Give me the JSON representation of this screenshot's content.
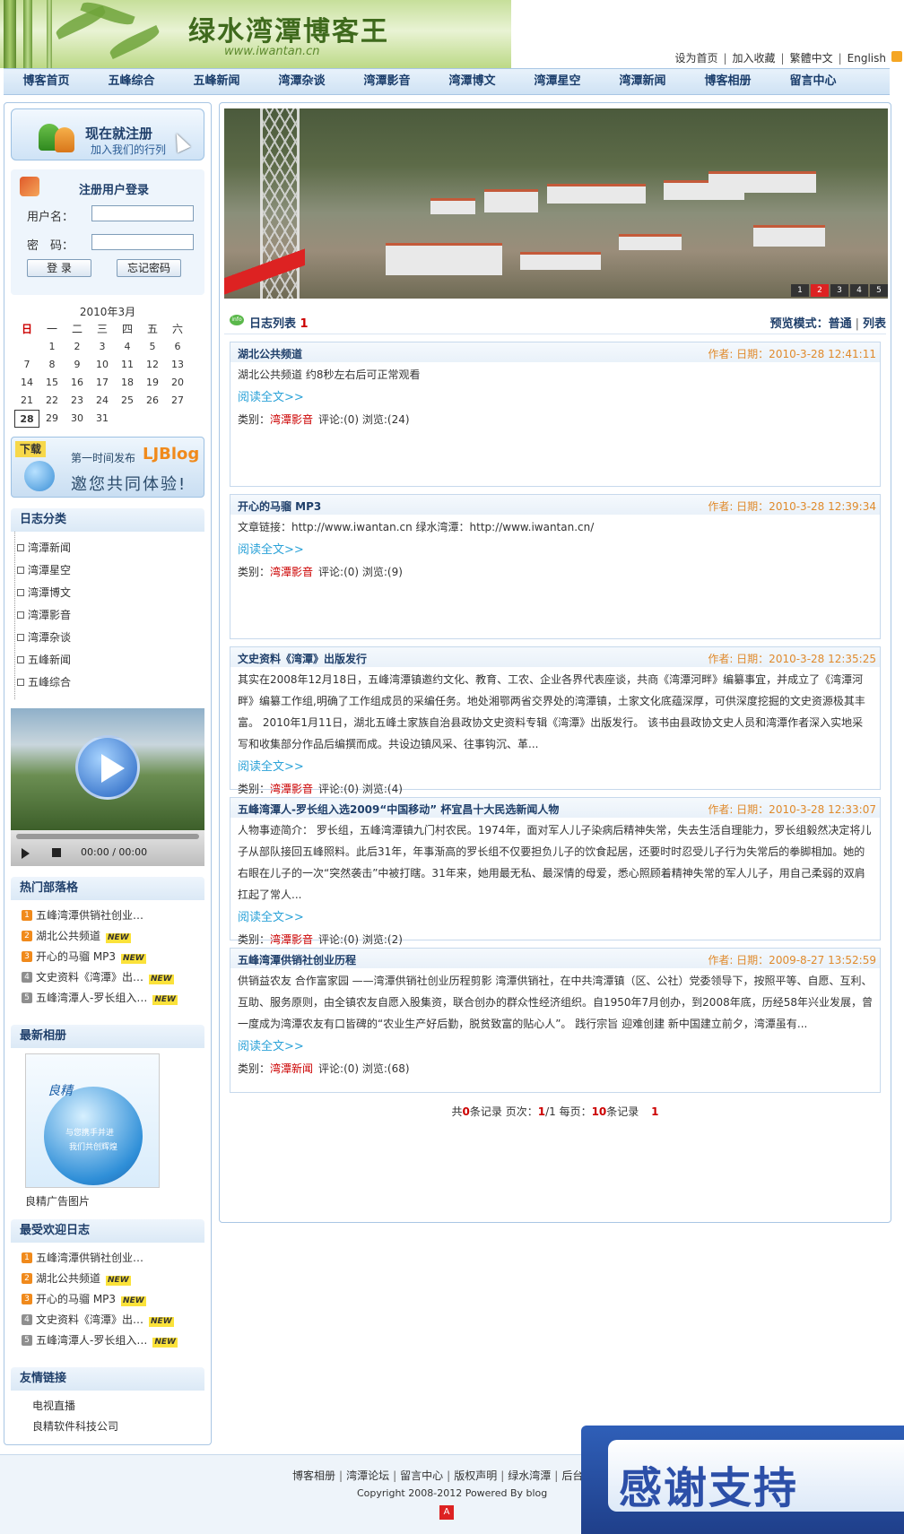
{
  "banner": {
    "title": "绿水湾潭博客王",
    "url": "www.iwantan.cn"
  },
  "toplinks": [
    "设为首页",
    "加入收藏",
    "繁體中文",
    "English"
  ],
  "nav": [
    "博客首页",
    "五峰综合",
    "五峰新闻",
    "湾潭杂谈",
    "湾潭影音",
    "湾潭博文",
    "湾潭星空",
    "湾潭新闻",
    "博客相册",
    "留言中心"
  ],
  "register": {
    "title": "现在就注册",
    "subtitle": "加入我们的行列"
  },
  "login": {
    "title": "注册用户登录",
    "username_label": "用户名：",
    "password_label": "密　码：",
    "login_button": "登 录",
    "forget_button": "忘记密码"
  },
  "calendar": {
    "title": "2010年3月",
    "days_of_week": [
      "日",
      "一",
      "二",
      "三",
      "四",
      "五",
      "六"
    ],
    "days": [
      "",
      "1",
      "2",
      "3",
      "4",
      "5",
      "6",
      "7",
      "8",
      "9",
      "10",
      "11",
      "12",
      "13",
      "14",
      "15",
      "16",
      "17",
      "18",
      "19",
      "20",
      "21",
      "22",
      "23",
      "24",
      "25",
      "26",
      "27",
      "28",
      "29",
      "30",
      "31"
    ],
    "today": "28"
  },
  "download_banner": {
    "tag": "下载",
    "text1": "第一时间发布",
    "brand": "LJBlog",
    "text2": "邀您共同体验!"
  },
  "categories": {
    "title": "日志分类",
    "items": [
      "湾潭新闻",
      "湾潭星空",
      "湾潭博文",
      "湾潭影音",
      "湾潭杂谈",
      "五峰新闻",
      "五峰综合"
    ]
  },
  "video": {
    "time": "00:00 / 00:00"
  },
  "hot": {
    "title": "热门部落格",
    "items": [
      {
        "num": "1",
        "text": "五峰湾潭供销社创业…",
        "new": ""
      },
      {
        "num": "2",
        "text": "湖北公共频道",
        "new": "NEW"
      },
      {
        "num": "3",
        "text": "开心的马骝  MP3",
        "new": "NEW"
      },
      {
        "num": "4",
        "text": "文史资料《湾潭》出…",
        "new": "NEW"
      },
      {
        "num": "5",
        "text": "五峰湾潭人-罗长组入…",
        "new": "NEW"
      }
    ]
  },
  "album": {
    "title": "最新相册",
    "brand": "良精",
    "line1": "与您携手并进",
    "line2": "我们共创辉煌",
    "caption": "良精广告图片"
  },
  "popular": {
    "title": "最受欢迎日志",
    "items": [
      {
        "num": "1",
        "text": "五峰湾潭供销社创业…",
        "new": ""
      },
      {
        "num": "2",
        "text": "湖北公共频道",
        "new": "NEW"
      },
      {
        "num": "3",
        "text": "开心的马骝  MP3",
        "new": "NEW"
      },
      {
        "num": "4",
        "text": "文史资料《湾潭》出…",
        "new": "NEW"
      },
      {
        "num": "5",
        "text": "五峰湾潭人-罗长组入…",
        "new": "NEW"
      }
    ]
  },
  "links": {
    "title": "友情链接",
    "items": [
      "电视直播",
      "良精软件科技公司"
    ]
  },
  "slideshow": {
    "numbers": [
      "1",
      "2",
      "3",
      "4",
      "5"
    ],
    "active": "2"
  },
  "log": {
    "title": "日志列表",
    "count": "1",
    "preview_label": "预览模式：",
    "mode_normal": "普通",
    "mode_list": "列表"
  },
  "entries": [
    {
      "title": "湖北公共频道",
      "meta": "作者: 日期：2010-3-28 12:41:11",
      "body": "湖北公共频道  约8秒左右后可正常观看",
      "more": "阅读全文>>",
      "category_label": "类别：",
      "category": "湾潭影音",
      "stats": "评论:(0)  浏览:(24)"
    },
    {
      "title": "开心的马骝  MP3",
      "meta": "作者: 日期：2010-3-28 12:39:34",
      "body": "文章链接：http://www.iwantan.cn 绿水湾潭：http://www.iwantan.cn/",
      "more": "阅读全文>>",
      "category_label": "类别：",
      "category": "湾潭影音",
      "stats": "评论:(0)  浏览:(9)"
    },
    {
      "title": "文史资料《湾潭》出版发行",
      "meta": "作者: 日期：2010-3-28 12:35:25",
      "body": "其实在2008年12月18日，五峰湾潭镇邀约文化、教育、工农、企业各界代表座谈，共商《湾潭河畔》编纂事宜，并成立了《湾潭河畔》编纂工作组,明确了工作组成员的采编任务。地处湘鄂两省交界处的湾潭镇，土家文化底蕴深厚，可供深度挖掘的文史资源极其丰富。 2010年1月11日，湖北五峰土家族自治县政协文史资料专辑《湾潭》出版发行。 该书由县政协文史人员和湾潭作者深入实地采写和收集部分作品后编撰而成。共设边镇风采、往事钩沉、革...",
      "more": "阅读全文>>",
      "category_label": "类别：",
      "category": "湾潭影音",
      "stats": "评论:(0)  浏览:(4)"
    },
    {
      "title": "五峰湾潭人-罗长组入选2009“中国移动” 杯宜昌十大民选新闻人物",
      "meta": "作者: 日期：2010-3-28 12:33:07",
      "body": "人物事迹简介： 罗长组，五峰湾潭镇九门村农民。1974年，面对军人儿子染病后精神失常，失去生活自理能力，罗长组毅然决定将儿子从部队接回五峰照料。此后31年，年事渐高的罗长组不仅要担负儿子的饮食起居，还要时时忍受儿子行为失常后的拳脚相加。她的右眼在儿子的一次“突然袭击”中被打瞎。31年来，她用最无私、最深情的母爱，悉心照顾着精神失常的军人儿子，用自己柔弱的双肩扛起了常人...",
      "more": "阅读全文>>",
      "category_label": "类别：",
      "category": "湾潭影音",
      "stats": "评论:(0)  浏览:(2)"
    },
    {
      "title": "五峰湾潭供销社创业历程",
      "meta": "作者: 日期：2009-8-27 13:52:59",
      "body": "供销益农友  合作富家园 ——湾潭供销社创业历程剪影  湾潭供销社，在中共湾潭镇（区、公社）党委领导下，按照平等、自愿、互利、互助、服务原则，由全镇农友自愿入股集资，联合创办的群众性经济组织。自1950年7月创办，到2008年底，历经58年兴业发展，曾一度成为湾潭农友有口皆碑的“农业生产好后勤，脱贫致富的贴心人”。  践行宗旨   迎难创建  新中国建立前夕，湾潭虽有...",
      "more": "阅读全文>>",
      "category_label": "类别：",
      "category": "湾潭新闻",
      "stats": "评论:(0)  浏览:(68)"
    }
  ],
  "pager": {
    "prefix": "共",
    "records": "0",
    "records_suffix": "条记录  页次：",
    "page": "1",
    "page_total": "/1 每页：",
    "per_page": "10",
    "per_page_suffix": "条记录",
    "current": "1"
  },
  "footer": {
    "links": [
      "博客相册",
      "湾潭论坛",
      "留言中心",
      "版权声明",
      "绿水湾潭",
      "后台"
    ],
    "copyright": "Copyright 2008-2012 Powered By blog",
    "logo": "A"
  },
  "thanks": "感谢支持"
}
